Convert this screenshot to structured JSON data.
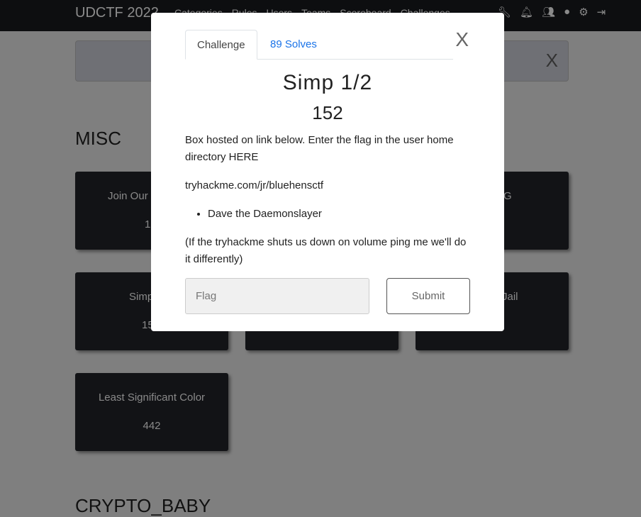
{
  "nav": {
    "brand": "UDCTF 2022",
    "links": [
      "Categories",
      "Rules",
      "Users",
      "Teams",
      "Scoreboard",
      "Challenges"
    ],
    "icons": [
      "wrench-icon",
      "bell-icon",
      "users-icon",
      "user-circle-icon",
      "cogs-icon",
      "logout-icon"
    ]
  },
  "alert": {
    "close": "X"
  },
  "sections": [
    "MISC",
    "CRYPTO_BABY"
  ],
  "cards": [
    {
      "title": "Join Our",
      "value": "1"
    },
    {
      "title": "G",
      "value": ""
    },
    {
      "title": "Simp",
      "value": "15"
    },
    {
      "title": "",
      "value": ""
    },
    {
      "title": "Jail",
      "value": ""
    },
    {
      "title": "Least Significant Color",
      "value": "442"
    }
  ],
  "modal": {
    "tabs": [
      "Challenge",
      "89 Solves"
    ],
    "close": "X",
    "title": "Simp 1/2",
    "value": "152",
    "description": "Box hosted on link below. Enter the flag in the user home directory HERE",
    "link": "tryhackme.com/jr/bluehensctf",
    "bullets": [
      "Dave the Daemonslayer"
    ],
    "note": "(If the tryhackme shuts us down on volume ping me we'll do it differently)",
    "flag_placeholder": "Flag",
    "submit": "Submit"
  }
}
